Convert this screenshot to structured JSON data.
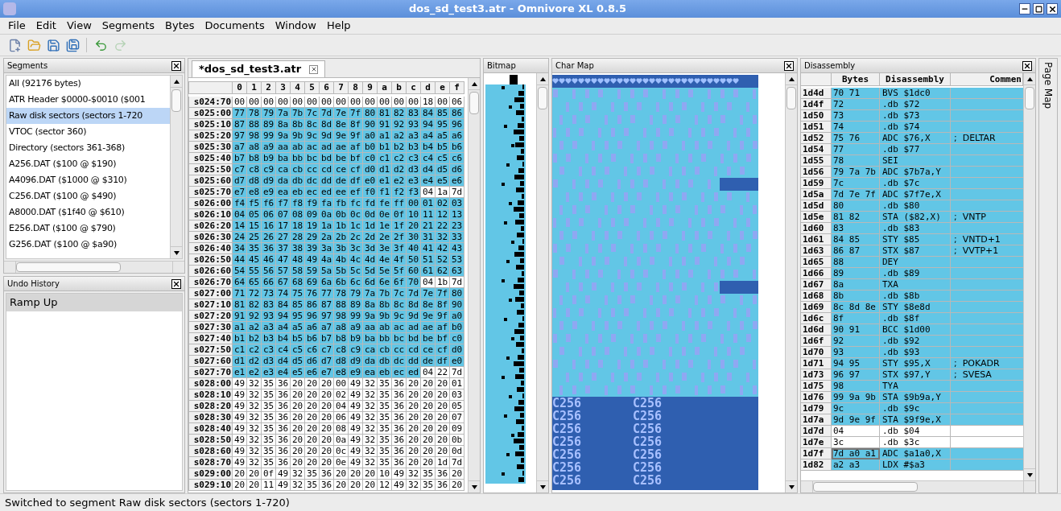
{
  "window": {
    "title": "dos_sd_test3.atr - Omnivore XL 0.8.5"
  },
  "menu": [
    "File",
    "Edit",
    "View",
    "Segments",
    "Bytes",
    "Documents",
    "Window",
    "Help"
  ],
  "toolbar": [
    {
      "disabled": false
    },
    {
      "disabled": false
    },
    {
      "disabled": false
    },
    {
      "disabled": false
    },
    {
      "disabled": false
    },
    {
      "disabled": true
    }
  ],
  "segments": {
    "title": "Segments",
    "items": [
      {
        "label": "All (92176 bytes)",
        "selected": false
      },
      {
        "label": "ATR Header $0000-$0010 ($001",
        "selected": false
      },
      {
        "label": "Raw disk sectors (sectors 1-720",
        "selected": true
      },
      {
        "label": "VTOC (sector 360)",
        "selected": false
      },
      {
        "label": "Directory (sectors 361-368)",
        "selected": false
      },
      {
        "label": "A256.DAT ($100 @ $190)",
        "selected": false
      },
      {
        "label": "A4096.DAT ($1000 @ $310)",
        "selected": false
      },
      {
        "label": "C256.DAT ($100 @ $490)",
        "selected": false
      },
      {
        "label": "A8000.DAT ($1f40 @ $610)",
        "selected": false
      },
      {
        "label": "E256.DAT ($100 @ $790)",
        "selected": false
      },
      {
        "label": "G256.DAT ($100 @ $a90)",
        "selected": false
      }
    ]
  },
  "undo_history": {
    "title": "Undo History",
    "items": [
      {
        "label": "Ramp Up",
        "selected": true
      }
    ]
  },
  "hex_editor": {
    "tab": {
      "label": "*dos_sd_test3.atr",
      "selected": true
    },
    "columns": [
      "0",
      "1",
      "2",
      "3",
      "4",
      "5",
      "6",
      "7",
      "8",
      "9",
      "a",
      "b",
      "c",
      "d",
      "e",
      "f"
    ],
    "rows": [
      {
        "address": "s024:70",
        "bytes": "00 00 00 00 00 00 00 00 00 00 00 00 00 18 00 06",
        "selected": [
          false,
          false,
          false,
          false,
          false,
          false,
          false,
          false,
          false,
          false,
          false,
          false,
          false,
          false,
          false,
          false
        ]
      },
      {
        "address": "s025:00",
        "bytes": "77 78 79 7a 7b 7c 7d 7e 7f 80 81 82 83 84 85 86",
        "selected": [
          true,
          true,
          true,
          true,
          true,
          true,
          true,
          true,
          true,
          true,
          true,
          true,
          true,
          true,
          true,
          true
        ]
      },
      {
        "address": "s025:10",
        "bytes": "87 88 89 8a 8b 8c 8d 8e 8f 90 91 92 93 94 95 96",
        "selected": [
          true,
          true,
          true,
          true,
          true,
          true,
          true,
          true,
          true,
          true,
          true,
          true,
          true,
          true,
          true,
          true
        ]
      },
      {
        "address": "s025:20",
        "bytes": "97 98 99 9a 9b 9c 9d 9e 9f a0 a1 a2 a3 a4 a5 a6",
        "selected": [
          true,
          true,
          true,
          true,
          true,
          true,
          true,
          true,
          true,
          true,
          true,
          true,
          true,
          true,
          true,
          true
        ]
      },
      {
        "address": "s025:30",
        "bytes": "a7 a8 a9 aa ab ac ad ae af b0 b1 b2 b3 b4 b5 b6",
        "selected": [
          true,
          true,
          true,
          true,
          true,
          true,
          true,
          true,
          true,
          true,
          true,
          true,
          true,
          true,
          true,
          true
        ]
      },
      {
        "address": "s025:40",
        "bytes": "b7 b8 b9 ba bb bc bd be bf c0 c1 c2 c3 c4 c5 c6",
        "selected": [
          true,
          true,
          true,
          true,
          true,
          true,
          true,
          true,
          true,
          true,
          true,
          true,
          true,
          true,
          true,
          true
        ]
      },
      {
        "address": "s025:50",
        "bytes": "c7 c8 c9 ca cb cc cd ce cf d0 d1 d2 d3 d4 d5 d6",
        "selected": [
          true,
          true,
          true,
          true,
          true,
          true,
          true,
          true,
          true,
          true,
          true,
          true,
          true,
          true,
          true,
          true
        ]
      },
      {
        "address": "s025:60",
        "bytes": "d7 d8 d9 da db dc dd de df e0 e1 e2 e3 e4 e5 e6",
        "selected": [
          true,
          true,
          true,
          true,
          true,
          true,
          true,
          true,
          true,
          true,
          true,
          true,
          true,
          true,
          true,
          true
        ]
      },
      {
        "address": "s025:70",
        "bytes": "e7 e8 e9 ea eb ec ed ee ef f0 f1 f2 f3 04 1a 7d",
        "selected": [
          true,
          true,
          true,
          true,
          true,
          true,
          true,
          true,
          true,
          true,
          true,
          true,
          true,
          false,
          false,
          false
        ]
      },
      {
        "address": "s026:00",
        "bytes": "f4 f5 f6 f7 f8 f9 fa fb fc fd fe ff 00 01 02 03",
        "selected": [
          true,
          true,
          true,
          true,
          true,
          true,
          true,
          true,
          true,
          true,
          true,
          true,
          true,
          true,
          true,
          true
        ]
      },
      {
        "address": "s026:10",
        "bytes": "04 05 06 07 08 09 0a 0b 0c 0d 0e 0f 10 11 12 13",
        "selected": [
          true,
          true,
          true,
          true,
          true,
          true,
          true,
          true,
          true,
          true,
          true,
          true,
          true,
          true,
          true,
          true
        ]
      },
      {
        "address": "s026:20",
        "bytes": "14 15 16 17 18 19 1a 1b 1c 1d 1e 1f 20 21 22 23",
        "selected": [
          true,
          true,
          true,
          true,
          true,
          true,
          true,
          true,
          true,
          true,
          true,
          true,
          true,
          true,
          true,
          true
        ]
      },
      {
        "address": "s026:30",
        "bytes": "24 25 26 27 28 29 2a 2b 2c 2d 2e 2f 30 31 32 33",
        "selected": [
          true,
          true,
          true,
          true,
          true,
          true,
          true,
          true,
          true,
          true,
          true,
          true,
          true,
          true,
          true,
          true
        ]
      },
      {
        "address": "s026:40",
        "bytes": "34 35 36 37 38 39 3a 3b 3c 3d 3e 3f 40 41 42 43",
        "selected": [
          true,
          true,
          true,
          true,
          true,
          true,
          true,
          true,
          true,
          true,
          true,
          true,
          true,
          true,
          true,
          true
        ]
      },
      {
        "address": "s026:50",
        "bytes": "44 45 46 47 48 49 4a 4b 4c 4d 4e 4f 50 51 52 53",
        "selected": [
          true,
          true,
          true,
          true,
          true,
          true,
          true,
          true,
          true,
          true,
          true,
          true,
          true,
          true,
          true,
          true
        ]
      },
      {
        "address": "s026:60",
        "bytes": "54 55 56 57 58 59 5a 5b 5c 5d 5e 5f 60 61 62 63",
        "selected": [
          true,
          true,
          true,
          true,
          true,
          true,
          true,
          true,
          true,
          true,
          true,
          true,
          true,
          true,
          true,
          true
        ]
      },
      {
        "address": "s026:70",
        "bytes": "64 65 66 67 68 69 6a 6b 6c 6d 6e 6f 70 04 1b 7d",
        "selected": [
          true,
          true,
          true,
          true,
          true,
          true,
          true,
          true,
          true,
          true,
          true,
          true,
          true,
          false,
          false,
          false
        ]
      },
      {
        "address": "s027:00",
        "bytes": "71 72 73 74 75 76 77 78 79 7a 7b 7c 7d 7e 7f 80",
        "selected": [
          true,
          true,
          true,
          true,
          true,
          true,
          true,
          true,
          true,
          true,
          true,
          true,
          true,
          true,
          true,
          true
        ]
      },
      {
        "address": "s027:10",
        "bytes": "81 82 83 84 85 86 87 88 89 8a 8b 8c 8d 8e 8f 90",
        "selected": [
          true,
          true,
          true,
          true,
          true,
          true,
          true,
          true,
          true,
          true,
          true,
          true,
          true,
          true,
          true,
          true
        ]
      },
      {
        "address": "s027:20",
        "bytes": "91 92 93 94 95 96 97 98 99 9a 9b 9c 9d 9e 9f a0",
        "selected": [
          true,
          true,
          true,
          true,
          true,
          true,
          true,
          true,
          true,
          true,
          true,
          true,
          true,
          true,
          true,
          true
        ]
      },
      {
        "address": "s027:30",
        "bytes": "a1 a2 a3 a4 a5 a6 a7 a8 a9 aa ab ac ad ae af b0",
        "selected": [
          true,
          true,
          true,
          true,
          true,
          true,
          true,
          true,
          true,
          true,
          true,
          true,
          true,
          true,
          true,
          true
        ]
      },
      {
        "address": "s027:40",
        "bytes": "b1 b2 b3 b4 b5 b6 b7 b8 b9 ba bb bc bd be bf c0",
        "selected": [
          true,
          true,
          true,
          true,
          true,
          true,
          true,
          true,
          true,
          true,
          true,
          true,
          true,
          true,
          true,
          true
        ]
      },
      {
        "address": "s027:50",
        "bytes": "c1 c2 c3 c4 c5 c6 c7 c8 c9 ca cb cc cd ce cf d0",
        "selected": [
          true,
          true,
          true,
          true,
          true,
          true,
          true,
          true,
          true,
          true,
          true,
          true,
          true,
          true,
          true,
          true
        ]
      },
      {
        "address": "s027:60",
        "bytes": "d1 d2 d3 d4 d5 d6 d7 d8 d9 da db dc dd de df e0",
        "selected": [
          true,
          true,
          true,
          true,
          true,
          true,
          true,
          true,
          true,
          true,
          true,
          true,
          true,
          true,
          true,
          true
        ]
      },
      {
        "address": "s027:70",
        "bytes": "e1 e2 e3 e4 e5 e6 e7 e8 e9 ea eb ec ed 04 22 7d",
        "selected": [
          true,
          true,
          true,
          true,
          true,
          true,
          true,
          true,
          true,
          true,
          true,
          true,
          true,
          false,
          false,
          false
        ]
      },
      {
        "address": "s028:00",
        "bytes": "49 32 35 36 20 20 20 00 49 32 35 36 20 20 20 01",
        "selected": [
          false,
          false,
          false,
          false,
          false,
          false,
          false,
          false,
          false,
          false,
          false,
          false,
          false,
          false,
          false,
          false
        ]
      },
      {
        "address": "s028:10",
        "bytes": "49 32 35 36 20 20 20 02 49 32 35 36 20 20 20 03",
        "selected": [
          false,
          false,
          false,
          false,
          false,
          false,
          false,
          false,
          false,
          false,
          false,
          false,
          false,
          false,
          false,
          false
        ]
      },
      {
        "address": "s028:20",
        "bytes": "49 32 35 36 20 20 20 04 49 32 35 36 20 20 20 05",
        "selected": [
          false,
          false,
          false,
          false,
          false,
          false,
          false,
          false,
          false,
          false,
          false,
          false,
          false,
          false,
          false,
          false
        ]
      },
      {
        "address": "s028:30",
        "bytes": "49 32 35 36 20 20 20 06 49 32 35 36 20 20 20 07",
        "selected": [
          false,
          false,
          false,
          false,
          false,
          false,
          false,
          false,
          false,
          false,
          false,
          false,
          false,
          false,
          false,
          false
        ]
      },
      {
        "address": "s028:40",
        "bytes": "49 32 35 36 20 20 20 08 49 32 35 36 20 20 20 09",
        "selected": [
          false,
          false,
          false,
          false,
          false,
          false,
          false,
          false,
          false,
          false,
          false,
          false,
          false,
          false,
          false,
          false
        ]
      },
      {
        "address": "s028:50",
        "bytes": "49 32 35 36 20 20 20 0a 49 32 35 36 20 20 20 0b",
        "selected": [
          false,
          false,
          false,
          false,
          false,
          false,
          false,
          false,
          false,
          false,
          false,
          false,
          false,
          false,
          false,
          false
        ]
      },
      {
        "address": "s028:60",
        "bytes": "49 32 35 36 20 20 20 0c 49 32 35 36 20 20 20 0d",
        "selected": [
          false,
          false,
          false,
          false,
          false,
          false,
          false,
          false,
          false,
          false,
          false,
          false,
          false,
          false,
          false,
          false
        ]
      },
      {
        "address": "s028:70",
        "bytes": "49 32 35 36 20 20 20 0e 49 32 35 36 20 20 1d 7d",
        "selected": [
          false,
          false,
          false,
          false,
          false,
          false,
          false,
          false,
          false,
          false,
          false,
          false,
          false,
          false,
          false,
          false
        ]
      },
      {
        "address": "s029:00",
        "bytes": "20 20 0f 49 32 35 36 20 20 20 10 49 32 35 36 20",
        "selected": [
          false,
          false,
          false,
          false,
          false,
          false,
          false,
          false,
          false,
          false,
          false,
          false,
          false,
          false,
          false,
          false
        ]
      },
      {
        "address": "s029:10",
        "bytes": "20 20 11 49 32 35 36 20 20 20 12 49 32 35 36 20",
        "selected": [
          false,
          false,
          false,
          false,
          false,
          false,
          false,
          false,
          false,
          false,
          false,
          false,
          false,
          false,
          false,
          false
        ]
      }
    ]
  },
  "bitmap": {
    "title": "Bitmap"
  },
  "char_map": {
    "title": "Char Map",
    "glyph_rows": [
      {
        "left": "C256",
        "right": "C256"
      },
      {
        "left": "C256",
        "right": "C256"
      },
      {
        "left": "C256",
        "right": "C256"
      },
      {
        "left": "C256",
        "right": "C256"
      },
      {
        "left": "C256",
        "right": "C256"
      },
      {
        "left": "C256",
        "right": "C256"
      },
      {
        "left": "C256",
        "right": "C256"
      }
    ]
  },
  "disassembly": {
    "title": "Disassembly",
    "columns": [
      "Bytes",
      "Disassembly",
      "Commen"
    ],
    "rows": [
      {
        "address": "1d4d",
        "bytes": "70 71",
        "instruction": "BVS $1dc0",
        "comment": "",
        "selected": true,
        "cursor": false
      },
      {
        "address": "1d4f",
        "bytes": "72",
        "instruction": ".db $72",
        "comment": "",
        "selected": true,
        "cursor": false
      },
      {
        "address": "1d50",
        "bytes": "73",
        "instruction": ".db $73",
        "comment": "",
        "selected": true,
        "cursor": false
      },
      {
        "address": "1d51",
        "bytes": "74",
        "instruction": ".db $74",
        "comment": "",
        "selected": true,
        "cursor": false
      },
      {
        "address": "1d52",
        "bytes": "75 76",
        "instruction": "ADC $76,X",
        "comment": ";  DELTAR",
        "selected": true,
        "cursor": false
      },
      {
        "address": "1d54",
        "bytes": "77",
        "instruction": ".db $77",
        "comment": "",
        "selected": true,
        "cursor": false
      },
      {
        "address": "1d55",
        "bytes": "78",
        "instruction": "SEI",
        "comment": "",
        "selected": true,
        "cursor": false
      },
      {
        "address": "1d56",
        "bytes": "79 7a 7b",
        "instruction": "ADC $7b7a,Y",
        "comment": "",
        "selected": true,
        "cursor": false
      },
      {
        "address": "1d59",
        "bytes": "7c",
        "instruction": ".db $7c",
        "comment": "",
        "selected": true,
        "cursor": false
      },
      {
        "address": "1d5a",
        "bytes": "7d 7e 7f",
        "instruction": "ADC $7f7e,X",
        "comment": "",
        "selected": true,
        "cursor": false
      },
      {
        "address": "1d5d",
        "bytes": "80",
        "instruction": ".db $80",
        "comment": "",
        "selected": true,
        "cursor": false
      },
      {
        "address": "1d5e",
        "bytes": "81 82",
        "instruction": "STA ($82,X)",
        "comment": ";  VNTP",
        "selected": true,
        "cursor": false
      },
      {
        "address": "1d60",
        "bytes": "83",
        "instruction": ".db $83",
        "comment": "",
        "selected": true,
        "cursor": false
      },
      {
        "address": "1d61",
        "bytes": "84 85",
        "instruction": "STY $85",
        "comment": ";  VNTD+1",
        "selected": true,
        "cursor": false
      },
      {
        "address": "1d63",
        "bytes": "86 87",
        "instruction": "STX $87",
        "comment": ";  VVTP+1",
        "selected": true,
        "cursor": false
      },
      {
        "address": "1d65",
        "bytes": "88",
        "instruction": "DEY",
        "comment": "",
        "selected": true,
        "cursor": false
      },
      {
        "address": "1d66",
        "bytes": "89",
        "instruction": ".db $89",
        "comment": "",
        "selected": true,
        "cursor": false
      },
      {
        "address": "1d67",
        "bytes": "8a",
        "instruction": "TXA",
        "comment": "",
        "selected": true,
        "cursor": false
      },
      {
        "address": "1d68",
        "bytes": "8b",
        "instruction": ".db $8b",
        "comment": "",
        "selected": true,
        "cursor": false
      },
      {
        "address": "1d69",
        "bytes": "8c 8d 8e",
        "instruction": "STY $8e8d",
        "comment": "",
        "selected": true,
        "cursor": false
      },
      {
        "address": "1d6c",
        "bytes": "8f",
        "instruction": ".db $8f",
        "comment": "",
        "selected": true,
        "cursor": false
      },
      {
        "address": "1d6d",
        "bytes": "90 91",
        "instruction": "BCC $1d00",
        "comment": "",
        "selected": true,
        "cursor": false
      },
      {
        "address": "1d6f",
        "bytes": "92",
        "instruction": ".db $92",
        "comment": "",
        "selected": true,
        "cursor": false
      },
      {
        "address": "1d70",
        "bytes": "93",
        "instruction": ".db $93",
        "comment": "",
        "selected": true,
        "cursor": false
      },
      {
        "address": "1d71",
        "bytes": "94 95",
        "instruction": "STY $95,X",
        "comment": ";  POKADR",
        "selected": true,
        "cursor": false
      },
      {
        "address": "1d73",
        "bytes": "96 97",
        "instruction": "STX $97,Y",
        "comment": ";  SVESA",
        "selected": true,
        "cursor": false
      },
      {
        "address": "1d75",
        "bytes": "98",
        "instruction": "TYA",
        "comment": "",
        "selected": true,
        "cursor": false
      },
      {
        "address": "1d76",
        "bytes": "99 9a 9b",
        "instruction": "STA $9b9a,Y",
        "comment": "",
        "selected": true,
        "cursor": false
      },
      {
        "address": "1d79",
        "bytes": "9c",
        "instruction": ".db $9c",
        "comment": "",
        "selected": true,
        "cursor": false
      },
      {
        "address": "1d7a",
        "bytes": "9d 9e 9f",
        "instruction": "STA $9f9e,X",
        "comment": "",
        "selected": true,
        "cursor": false
      },
      {
        "address": "1d7d",
        "bytes": "04",
        "instruction": ".db $04",
        "comment": "",
        "selected": false,
        "cursor": false
      },
      {
        "address": "1d7e",
        "bytes": "3c",
        "instruction": ".db $3c",
        "comment": "",
        "selected": false,
        "cursor": false
      },
      {
        "address": "1d7f",
        "bytes": "7d a0 a1",
        "instruction": "ADC $a1a0,X",
        "comment": "",
        "selected": true,
        "cursor": true
      },
      {
        "address": "1d82",
        "bytes": "a2 a3",
        "instruction": "LDX #$a3",
        "comment": "",
        "selected": true,
        "cursor": false
      }
    ]
  },
  "page_map": {
    "title": "Page Map"
  },
  "status_bar": "Switched to segment Raw disk sectors (sectors 1-720)"
}
